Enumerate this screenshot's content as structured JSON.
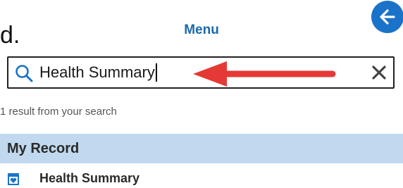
{
  "step_label": "d.",
  "header": {
    "title": "Menu",
    "back_icon": "arrow-left-icon",
    "accent_color": "#1a73c9"
  },
  "search": {
    "query": "Health Summary",
    "search_icon": "search-icon",
    "clear_icon": "close-icon"
  },
  "annotation": {
    "arrow_color": "#e53935"
  },
  "results": {
    "count_text": "1 result from your search",
    "sections": [
      {
        "title": "My Record",
        "items": [
          {
            "label": "Health Summary",
            "icon": "health-record-icon"
          }
        ]
      }
    ]
  }
}
